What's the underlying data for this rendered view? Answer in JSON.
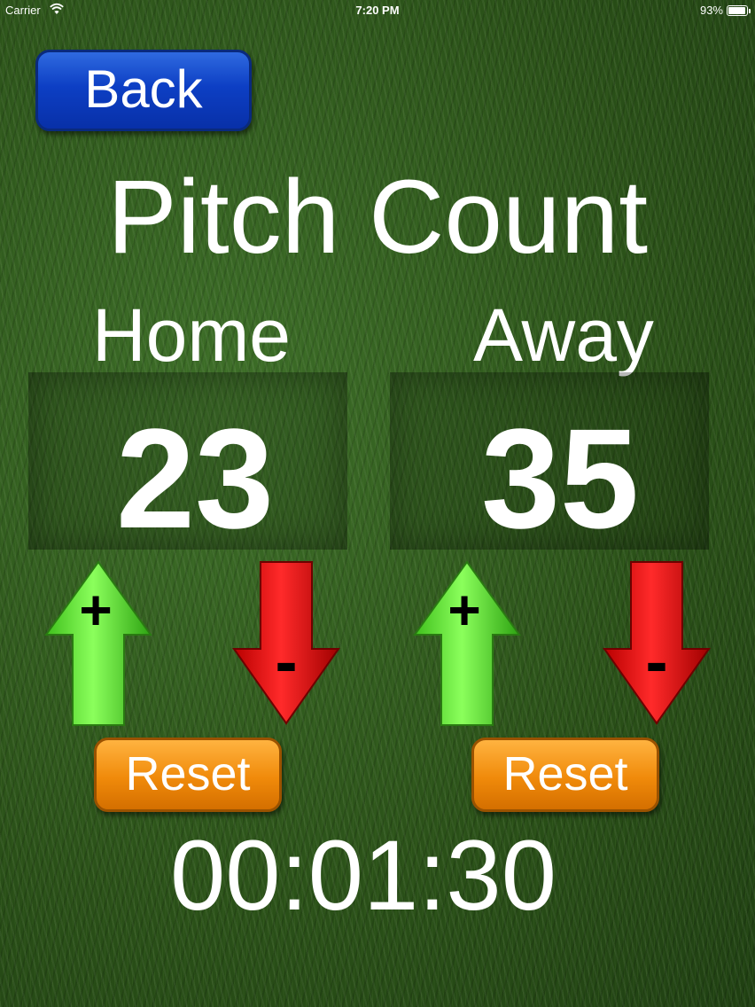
{
  "status_bar": {
    "carrier": "Carrier",
    "time": "7:20 PM",
    "battery_percent": "93%",
    "battery_level": 0.93
  },
  "back_label": "Back",
  "title": "Pitch Count",
  "home": {
    "label": "Home",
    "count": "23",
    "plus": "+",
    "minus": "-",
    "reset_label": "Reset"
  },
  "away": {
    "label": "Away",
    "count": "35",
    "plus": "+",
    "minus": "-",
    "reset_label": "Reset"
  },
  "timer": "00:01:30",
  "colors": {
    "back_button": "#0d3fc4",
    "increment_arrow": "#5fe23a",
    "decrement_arrow": "#e01010",
    "reset_button": "#f08a0a"
  },
  "icons": {
    "increment": "green-up-arrow-icon",
    "decrement": "red-down-arrow-icon",
    "wifi": "wifi-icon",
    "battery": "battery-icon"
  }
}
